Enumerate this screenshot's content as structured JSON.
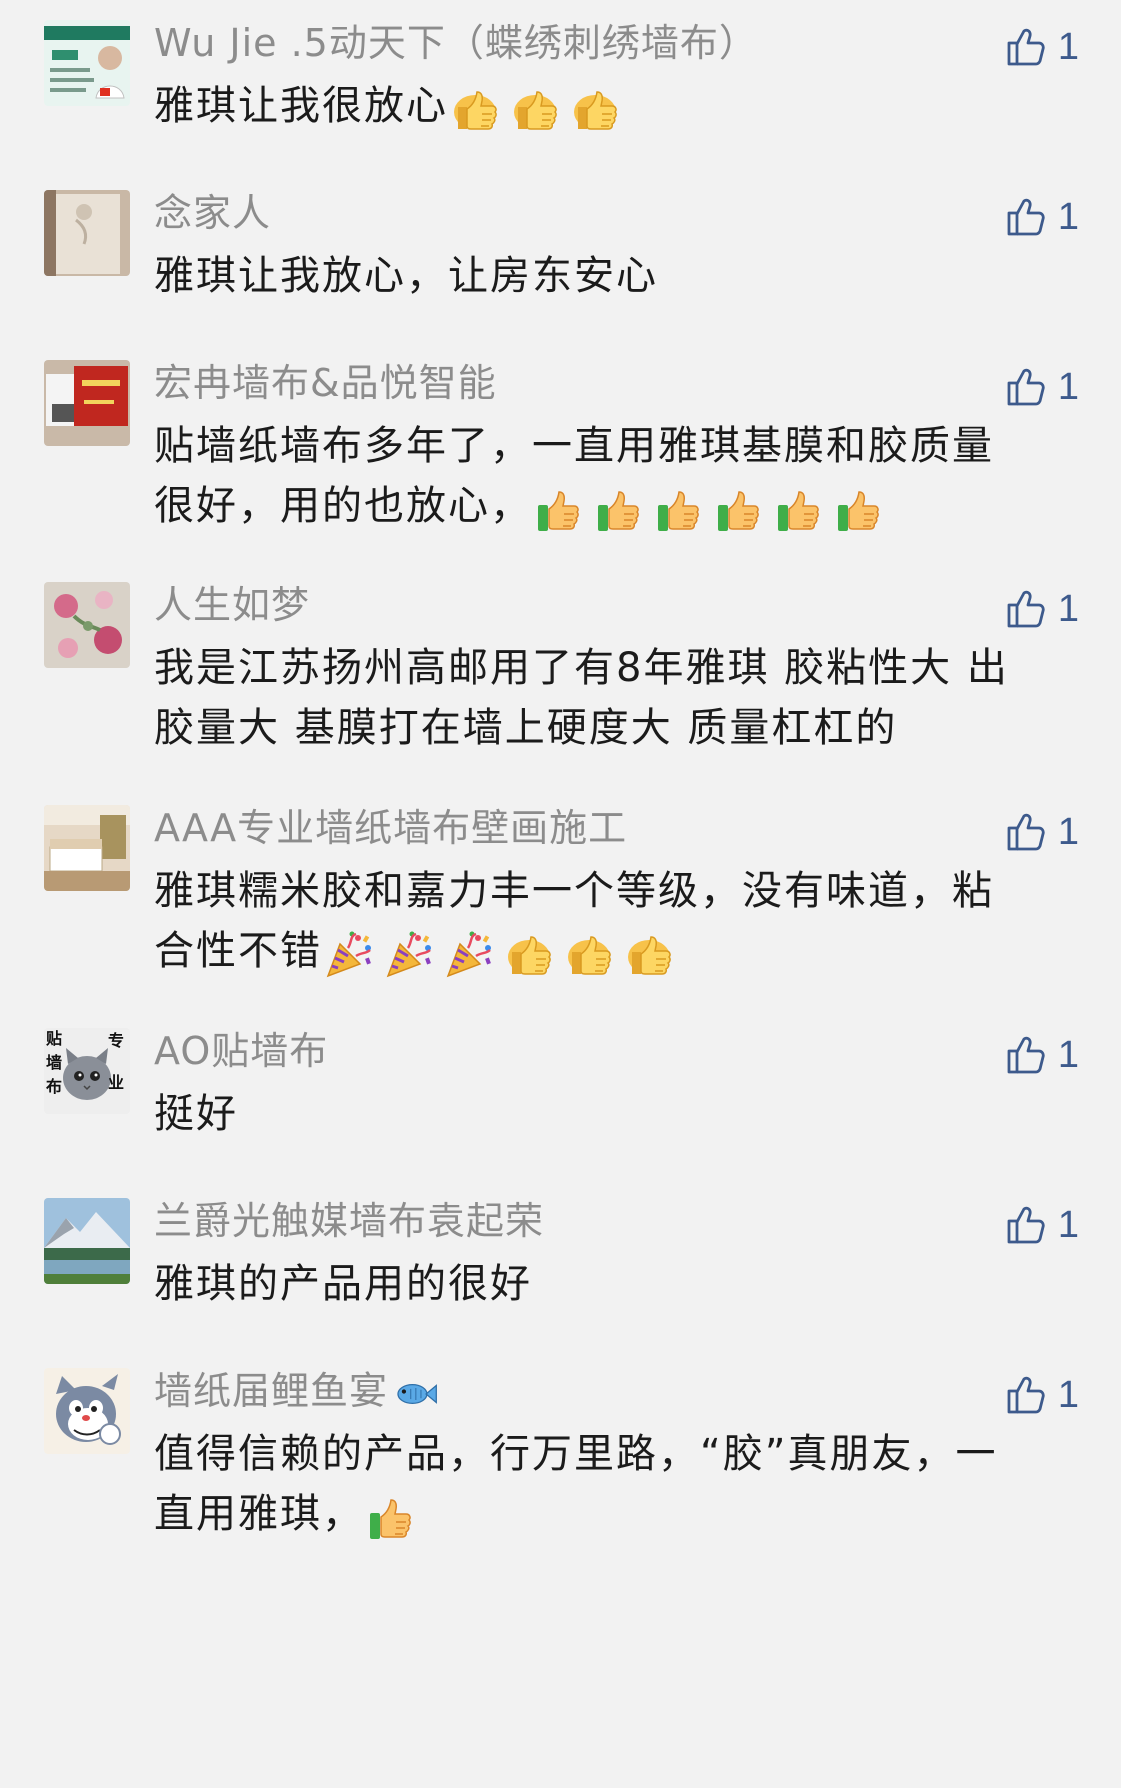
{
  "comments": [
    {
      "nickname": "Wu Jie .5动天下（蝶绣刺绣墙布）",
      "avatar_icon": "business-card-avatar",
      "lines": [
        {
          "text": "雅琪让我很放心",
          "emoji": [
            "thumbs-up",
            "thumbs-up",
            "thumbs-up"
          ]
        }
      ],
      "likes": "1"
    },
    {
      "nickname": "念家人",
      "avatar_icon": "wallpaper-photo-avatar",
      "lines": [
        {
          "text": "雅琪让我放心，让房东安心",
          "emoji": []
        }
      ],
      "likes": "1"
    },
    {
      "nickname": "宏冉墙布&品悦智能",
      "avatar_icon": "red-card-avatar",
      "lines": [
        {
          "text": "贴墙纸墙布多年了，一直用雅琪基膜和胶质量",
          "emoji": []
        },
        {
          "text": "很好，用的也放心，",
          "emoji": [
            "thumbs-up-boxed",
            "thumbs-up-boxed",
            "thumbs-up-boxed",
            "thumbs-up-boxed",
            "thumbs-up-boxed",
            "thumbs-up-boxed"
          ]
        }
      ],
      "likes": "1"
    },
    {
      "nickname": "人生如梦",
      "avatar_icon": "floral-wallpaper-avatar",
      "lines": [
        {
          "text": "我是江苏扬州高邮用了有8年雅琪 胶粘性大 出",
          "emoji": []
        },
        {
          "text": "胶量大 基膜打在墙上硬度大 质量杠杠的",
          "emoji": []
        }
      ],
      "likes": "1"
    },
    {
      "nickname": "AAA专业墙纸墙布壁画施工",
      "avatar_icon": "bedroom-photo-avatar",
      "lines": [
        {
          "text": "雅琪糯米胶和嘉力丰一个等级，没有味道，粘",
          "emoji": []
        },
        {
          "text": "合性不错",
          "emoji": [
            "party-popper",
            "party-popper",
            "party-popper",
            "thumbs-up",
            "thumbs-up",
            "thumbs-up"
          ]
        }
      ],
      "likes": "1"
    },
    {
      "nickname": "AO贴墙布",
      "avatar_icon": "cat-avatar",
      "avatar_text": [
        "贴",
        "墙",
        "布",
        "专",
        "业"
      ],
      "lines": [
        {
          "text": "挺好",
          "emoji": []
        }
      ],
      "likes": "1"
    },
    {
      "nickname": "兰爵光触媒墙布袁起荣",
      "avatar_icon": "mountain-lake-avatar",
      "lines": [
        {
          "text": "雅琪的产品用的很好",
          "emoji": []
        }
      ],
      "likes": "1"
    },
    {
      "nickname": "墙纸届鲤鱼宴",
      "nickname_emoji": "fish",
      "avatar_icon": "cartoon-cat-avatar",
      "lines": [
        {
          "text": "值得信赖的产品，行万里路，“胶”真朋友，一",
          "emoji": []
        },
        {
          "text": "直用雅琪，",
          "emoji": [
            "thumbs-up-boxed"
          ]
        }
      ],
      "likes": "1"
    }
  ],
  "colors": {
    "background": "#f2f2f2",
    "nickname": "#8c8c8c",
    "text": "#1b1b1b",
    "like": "#3d5a8c"
  }
}
